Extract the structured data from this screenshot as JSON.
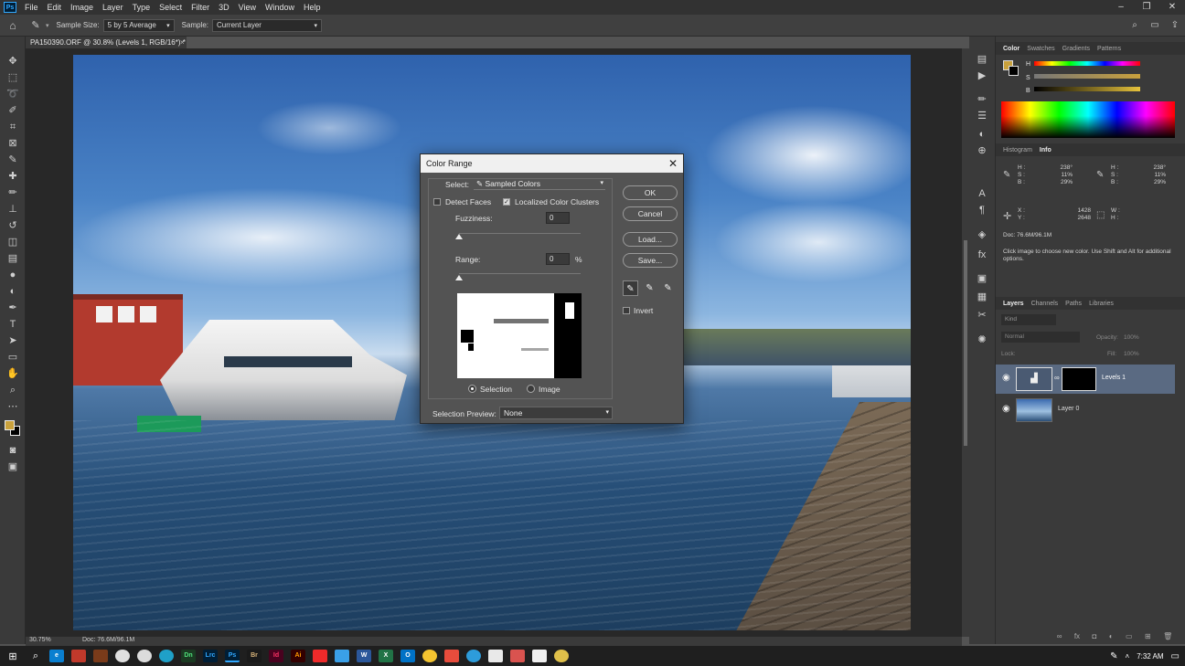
{
  "app": {
    "logo": "Ps"
  },
  "menu": [
    "File",
    "Edit",
    "Image",
    "Layer",
    "Type",
    "Select",
    "Filter",
    "3D",
    "View",
    "Window",
    "Help"
  ],
  "options": {
    "sample_size_label": "Sample Size:",
    "sample_size_value": "5 by 5 Average",
    "sample_label": "Sample:",
    "sample_value": "Current Layer"
  },
  "document": {
    "tab_title": "PA150390.ORF @ 30.8% (Levels 1, RGB/16*) *",
    "tab_close": "×",
    "zoom": "30.75%",
    "doc_size": "Doc: 76.6M/96.1M"
  },
  "dialog": {
    "title": "Color Range",
    "select_label": "Select:",
    "select_value": "Sampled Colors",
    "detect_faces": "Detect Faces",
    "detect_faces_checked": false,
    "localized_clusters": "Localized Color Clusters",
    "localized_clusters_checked": true,
    "fuzziness_label": "Fuzziness:",
    "fuzziness_value": "0",
    "range_label": "Range:",
    "range_value": "0",
    "range_unit": "%",
    "radio_selection": "Selection",
    "radio_image": "Image",
    "preview_label": "Selection Preview:",
    "preview_value": "None",
    "buttons": {
      "ok": "OK",
      "cancel": "Cancel",
      "load": "Load...",
      "save": "Save..."
    },
    "invert": "Invert",
    "invert_checked": false
  },
  "color_panel": {
    "tabs": [
      "Color",
      "Swatches",
      "Gradients",
      "Patterns"
    ],
    "sliders": [
      "H",
      "S",
      "B"
    ]
  },
  "info_panel": {
    "tabs": [
      "Histogram",
      "Info"
    ],
    "hsb_left_labels": [
      "H :",
      "S :",
      "B :"
    ],
    "hsb_left_values": [
      "238°",
      "11%",
      "29%"
    ],
    "hsb_right_labels": [
      "H :",
      "S :",
      "B :"
    ],
    "hsb_right_values": [
      "238°",
      "11%",
      "29%"
    ],
    "x_label": "X :",
    "x_value": "1428",
    "y_label": "Y :",
    "y_value": "2648",
    "w_label": "W :",
    "h_label": "H :",
    "doc": "Doc: 76.6M/96.1M",
    "hint": "Click image to choose new color.  Use Shift and Alt for additional options."
  },
  "layers_panel": {
    "tabs": [
      "Layers",
      "Channels",
      "Paths",
      "Libraries"
    ],
    "kind": "Kind",
    "blend_mode": "Normal",
    "opacity_label": "Opacity:",
    "opacity_value": "100%",
    "lock_label": "Lock:",
    "fill_label": "Fill:",
    "fill_value": "100%",
    "layers": [
      {
        "name": "Levels 1",
        "selected": true
      },
      {
        "name": "Layer 0",
        "selected": false
      }
    ]
  },
  "taskbar": {
    "time": "7:32 AM",
    "apps": [
      "Dn",
      "Lrc",
      "Ps",
      "Br",
      "Id",
      "Ai",
      "W",
      "X",
      "O"
    ]
  },
  "colors": {
    "accent": "#31a8ff",
    "foreground_swatch": "#c9a13c",
    "background_swatch": "#000000"
  }
}
